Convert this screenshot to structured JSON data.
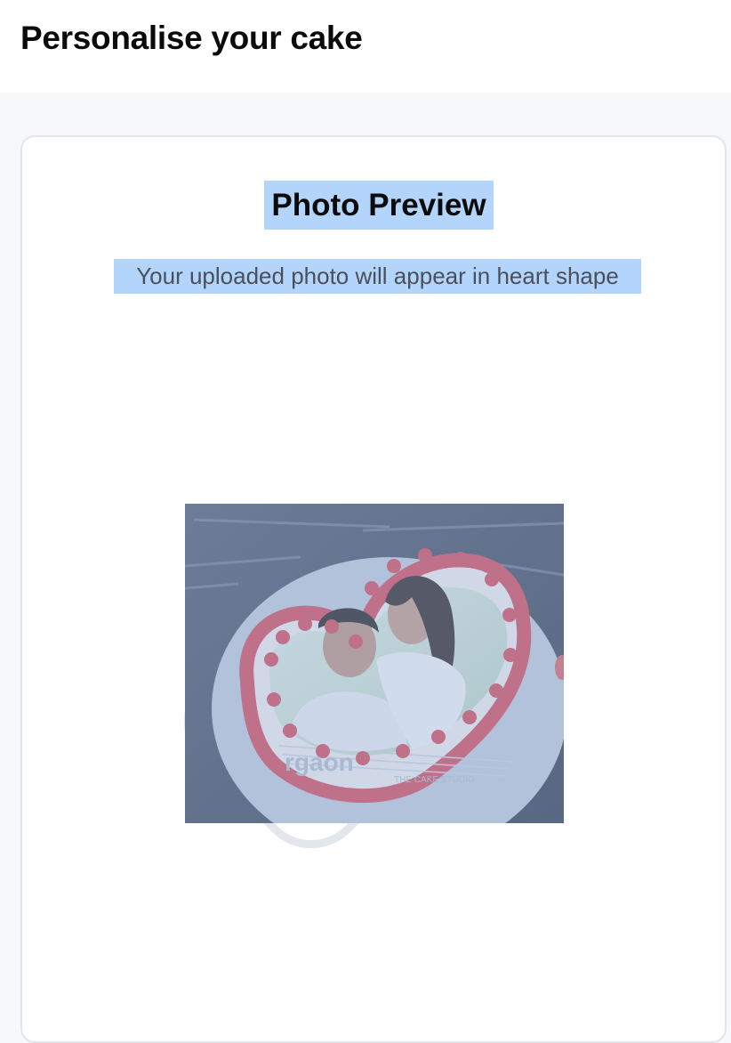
{
  "header": {
    "title": "Personalise your cake"
  },
  "preview": {
    "heading": "Photo Preview",
    "subtext": "Your uploaded photo will appear in heart shape"
  },
  "photo": {
    "cake_logo_text": "rgaon",
    "cake_logo_sub": "THE CAKE STUDIO"
  },
  "colors": {
    "selection_highlight": "#b4d5fb",
    "page_background": "#f7f8fa",
    "card_border": "#e3e5e9",
    "frosting": "#d9535f"
  }
}
